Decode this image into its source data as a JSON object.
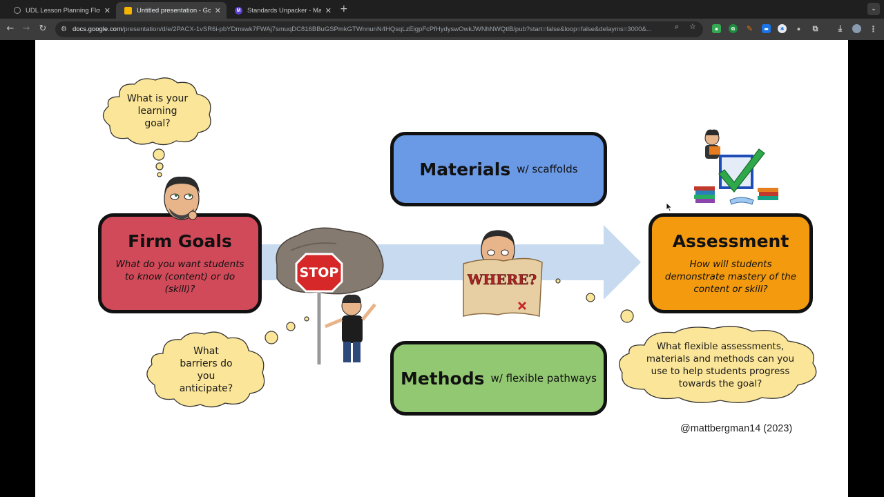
{
  "browser": {
    "tabs": [
      {
        "title": "UDL Lesson Planning Flowch",
        "favicon": "globe-icon",
        "active": false
      },
      {
        "title": "Untitled presentation - Goog",
        "favicon": "google-slides-icon",
        "active": true
      },
      {
        "title": "Standards Unpacker - Magic",
        "favicon": "magicschool-icon",
        "active": false
      }
    ],
    "url_host": "docs.google.com",
    "url_path": "/presentation/d/e/2PACX-1vSR6i-pbYDmswk7FWAj7smuqDC816BBuGSPmkGTWnnunN4HQsqLzEigpFcPfHydyswOwkJWNhNWQtlB/pub?start=false&loop=false&delayms=3000&..."
  },
  "slide": {
    "clouds": {
      "learning_goal": "What is your learning goal?",
      "barriers": "What barriers do you anticipate?",
      "flexible": "What flexible assessments, materials and methods can you use to help students progress towards the goal?"
    },
    "boxes": {
      "firm_goals": {
        "title": "Firm Goals",
        "subtitle": "What do you want students to know (content) or do (skill)?"
      },
      "materials": {
        "title": "Materials",
        "suffix": "w/ scaffolds"
      },
      "methods": {
        "title": "Methods",
        "suffix": "w/ flexible pathways"
      },
      "assessment": {
        "title": "Assessment",
        "subtitle": "How will students demonstrate mastery of the content or skill?"
      }
    },
    "signs": {
      "stop": "STOP",
      "where": "WHERE?"
    },
    "credit": "@mattbergman14 (2023)"
  },
  "colors": {
    "firm_goals": "#d14a5a",
    "materials": "#6a99e6",
    "methods": "#93c873",
    "assessment": "#f39a0f",
    "cloud": "#fbe598",
    "arrow": "#c7daf0"
  }
}
